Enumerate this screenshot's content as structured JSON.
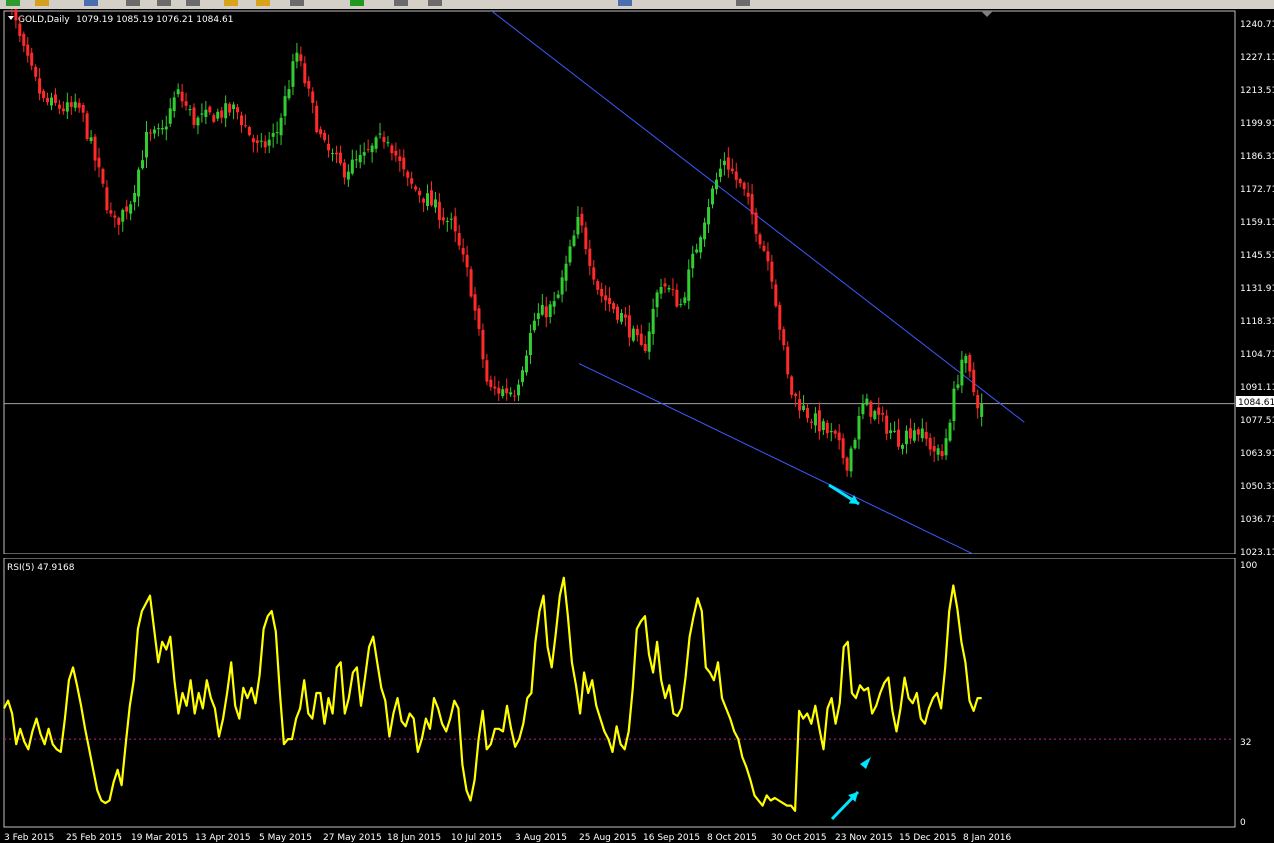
{
  "toolbar": {
    "buttons": [
      "green-arrow-icon",
      "folder-icon",
      "window-icon",
      "chart-icon",
      "chart-icon",
      "chart-icon",
      "pencil-icon",
      "pencil-icon",
      "chart-icon",
      "plus-icon",
      "chart-icon",
      "chart-icon",
      "window-icon",
      "chart-icon"
    ]
  },
  "main_chart": {
    "symbol_label": "GOLD,Daily",
    "ohlc_label": "1079.19 1085.19 1076.21 1084.61",
    "current_price_label": "1084.61",
    "price_ticks": [
      "1240.71",
      "1227.11",
      "1213.51",
      "1199.91",
      "1186.31",
      "1172.71",
      "1159.11",
      "1145.51",
      "1131.91",
      "1118.31",
      "1104.71",
      "1091.11",
      "1077.51",
      "1063.91",
      "1050.31",
      "1036.71",
      "1023.11"
    ]
  },
  "rsi_panel": {
    "label": "RSI(5) 47.9168",
    "ticks": [
      "100",
      "32",
      "0"
    ]
  },
  "date_axis": {
    "labels": [
      "3 Feb 2015",
      "25 Feb 2015",
      "19 Mar 2015",
      "13 Apr 2015",
      "5 May 2015",
      "27 May 2015",
      "18 Jun 2015",
      "10 Jul 2015",
      "3 Aug 2015",
      "25 Aug 2015",
      "16 Sep 2015",
      "8 Oct 2015",
      "30 Oct 2015",
      "23 Nov 2015",
      "15 Dec 2015",
      "8 Jan 2016"
    ]
  },
  "colors": {
    "background": "#000000",
    "bull_candle": "#32cd32",
    "bear_candle": "#ff2a2a",
    "channel_line": "#3c5aff",
    "rsi_line": "#ffff00",
    "arrow": "#00e5ff",
    "axis_text": "#ffffff"
  },
  "chart_data": {
    "type": "candlestick",
    "instrument": "GOLD",
    "timeframe": "Daily",
    "price_range": [
      1023.11,
      1246
    ],
    "last_close": 1084.61,
    "ohlc_current": {
      "open": 1079.19,
      "high": 1085.19,
      "low": 1076.21,
      "close": 1084.61
    },
    "close_path": [
      [
        "3 Feb 2015",
        1262
      ],
      [
        "2015-02-05",
        1248
      ],
      [
        "2015-02-10",
        1228
      ],
      [
        "2015-02-17",
        1208
      ],
      [
        "25 Feb 2015",
        1205
      ],
      [
        "2015-03-02",
        1205
      ],
      [
        "2015-03-09",
        1175
      ],
      [
        "2015-03-13",
        1157
      ],
      [
        "19 Mar 2015",
        1168
      ],
      [
        "2015-03-25",
        1193
      ],
      [
        "2015-03-31",
        1195
      ],
      [
        "2015-04-06",
        1212
      ],
      [
        "13 Apr 2015",
        1200
      ],
      [
        "2015-04-20",
        1203
      ],
      [
        "2015-04-27",
        1205
      ],
      [
        "5 May 2015",
        1188
      ],
      [
        "2015-05-11",
        1195
      ],
      [
        "2015-05-18",
        1228
      ],
      [
        "27 May 2015",
        1190
      ],
      [
        "2015-06-03",
        1180
      ],
      [
        "2015-06-10",
        1185
      ],
      [
        "18 Jun 2015",
        1195
      ],
      [
        "2015-06-25",
        1175
      ],
      [
        "2015-07-02",
        1168
      ],
      [
        "10 Jul 2015",
        1158
      ],
      [
        "2015-07-17",
        1135
      ],
      [
        "2015-07-24",
        1090
      ],
      [
        "3 Aug 2015",
        1090
      ],
      [
        "2015-08-10",
        1120
      ],
      [
        "2015-08-17",
        1125
      ],
      [
        "25 Aug 2015",
        1160
      ],
      [
        "2015-09-01",
        1130
      ],
      [
        "2015-09-09",
        1120
      ],
      [
        "16 Sep 2015",
        1105
      ],
      [
        "2015-09-22",
        1135
      ],
      [
        "2015-09-29",
        1125
      ],
      [
        "8 Oct 2015",
        1165
      ],
      [
        "2015-10-14",
        1185
      ],
      [
        "2015-10-21",
        1170
      ],
      [
        "30 Oct 2015",
        1140
      ],
      [
        "2015-11-06",
        1090
      ],
      [
        "2015-11-13",
        1080
      ],
      [
        "23 Nov 2015",
        1070
      ],
      [
        "2015-11-27",
        1060
      ],
      [
        "2015-12-03",
        1085
      ],
      [
        "15 Dec 2015",
        1070
      ],
      [
        "2015-12-21",
        1075
      ],
      [
        "2015-12-31",
        1062
      ],
      [
        "2016-01-05",
        1090
      ],
      [
        "8 Jan 2016",
        1105
      ],
      [
        "2016-01-13",
        1086
      ],
      [
        "2016-01-15",
        1084.61
      ]
    ],
    "channel": {
      "upper": [
        [
          "10 Jul 2015",
          1258
        ],
        [
          "2016-01-31",
          1077
        ]
      ],
      "lower": [
        [
          "25 Aug 2015",
          1101
        ],
        [
          "2016-01-12",
          1023
        ]
      ]
    },
    "rsi": {
      "period": 5,
      "current": 47.9168,
      "range": [
        0,
        100
      ],
      "level": 32,
      "values": [
        44,
        47,
        42,
        30,
        36,
        31,
        28,
        35,
        40,
        34,
        30,
        36,
        30,
        28,
        27,
        40,
        55,
        60,
        53,
        45,
        36,
        28,
        20,
        12,
        8,
        7,
        8,
        15,
        20,
        14,
        30,
        45,
        55,
        75,
        82,
        85,
        88,
        75,
        62,
        70,
        67,
        72,
        55,
        42,
        50,
        45,
        55,
        42,
        50,
        44,
        55,
        48,
        44,
        33,
        40,
        50,
        62,
        45,
        40,
        52,
        48,
        52,
        46,
        57,
        75,
        80,
        82,
        74,
        50,
        30,
        32,
        32,
        40,
        44,
        55,
        42,
        40,
        50,
        50,
        38,
        48,
        42,
        60,
        62,
        42,
        48,
        58,
        60,
        45,
        56,
        68,
        72,
        62,
        52,
        47,
        33,
        42,
        48,
        39,
        37,
        42,
        40,
        27,
        32,
        40,
        36,
        48,
        44,
        38,
        35,
        40,
        47,
        44,
        22,
        12,
        8,
        16,
        32,
        43,
        28,
        30,
        36,
        36,
        35,
        45,
        36,
        29,
        32,
        38,
        48,
        50,
        70,
        82,
        88,
        68,
        60,
        73,
        88,
        95,
        80,
        62,
        53,
        42,
        58,
        50,
        55,
        45,
        40,
        35,
        32,
        27,
        37,
        30,
        28,
        35,
        52,
        75,
        78,
        80,
        65,
        58,
        70,
        55,
        48,
        53,
        42,
        41,
        44,
        56,
        72,
        80,
        87,
        82,
        60,
        58,
        55,
        62,
        48,
        44,
        40,
        35,
        32,
        25,
        21,
        16,
        10,
        8,
        6,
        10,
        8,
        9,
        8,
        7,
        6,
        6,
        4,
        43,
        40,
        42,
        38,
        45,
        36,
        28,
        44,
        48,
        38,
        46,
        68,
        70,
        50,
        48,
        53,
        51,
        52,
        42,
        45,
        50,
        54,
        56,
        43,
        35,
        44,
        56,
        48,
        46,
        50,
        40,
        38,
        44,
        48,
        50,
        44,
        60,
        82,
        92,
        83,
        70,
        62,
        47,
        43,
        48,
        48
      ]
    }
  }
}
